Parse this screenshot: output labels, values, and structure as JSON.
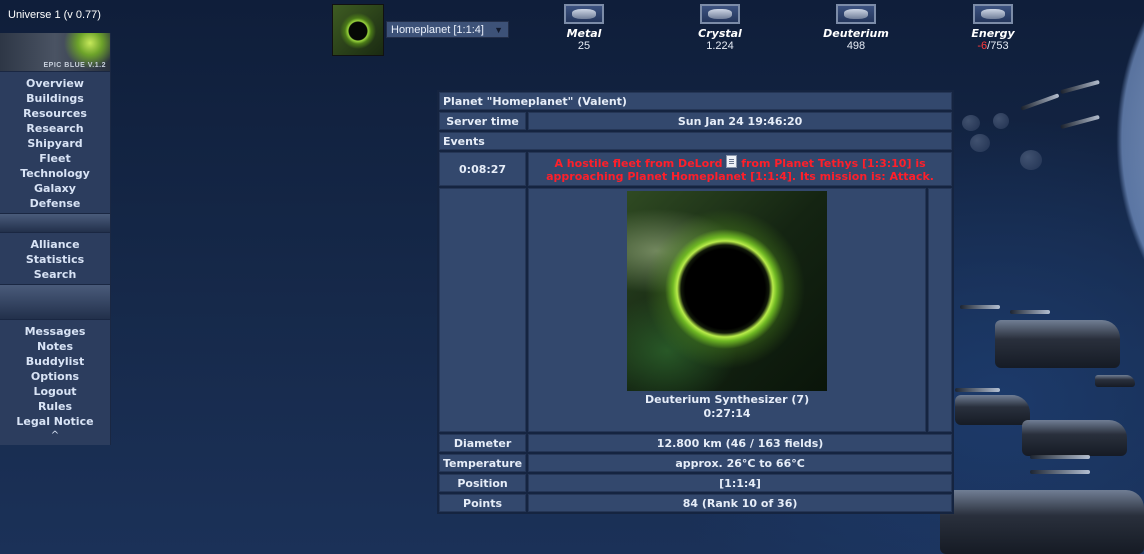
{
  "universe_label": "Universe 1 (v 0.77)",
  "logo_text": "EPIC BLUE V.1.2",
  "sidebar": {
    "group1": [
      "Overview",
      "Buildings",
      "Resources",
      "Research",
      "Shipyard",
      "Fleet",
      "Technology",
      "Galaxy",
      "Defense"
    ],
    "group2": [
      "Alliance",
      "Statistics",
      "Search"
    ],
    "group3": [
      "Messages",
      "Notes",
      "Buddylist",
      "Options",
      "Logout",
      "Rules",
      "Legal Notice"
    ],
    "scroll_top": "^"
  },
  "planet_selector": {
    "selected": "Homeplanet [1:1:4]",
    "arrow": "▼"
  },
  "resources": [
    {
      "name": "Metal",
      "value": "25",
      "icon": "metal-icon"
    },
    {
      "name": "Crystal",
      "value": "1.224",
      "icon": "crystal-icon"
    },
    {
      "name": "Deuterium",
      "value": "498",
      "icon": "deuterium-icon"
    },
    {
      "name": "Energy",
      "value_available": "-6",
      "value_total": "/753",
      "icon": "energy-icon"
    }
  ],
  "colors": {
    "alert": "#ff1f2a",
    "panel": "#33486d",
    "energy_negative": "#ff3a3a"
  },
  "overview": {
    "title": "Planet \"Homeplanet\" (Valent)",
    "server_time_label": "Server time",
    "server_time": "Sun Jan 24 19:46:20",
    "events_label": "Events",
    "event": {
      "countdown": "0:08:27",
      "text_before": "A hostile fleet from DeLord",
      "text_after": " from Planet Tethys [1:3:10] is approaching Planet Homeplanet [1:1:4]. Its mission is: Attack."
    },
    "construction": {
      "building": "Deuterium Synthesizer (7)",
      "time_left": "0:27:14"
    },
    "rows": [
      {
        "label": "Diameter",
        "value": "12.800 km (46 / 163 fields)"
      },
      {
        "label": "Temperature",
        "value": "approx. 26°C to 66°C"
      },
      {
        "label": "Position",
        "value": "[1:1:4]"
      },
      {
        "label": "Points",
        "value": "84 (Rank 10 of 36)"
      }
    ]
  }
}
